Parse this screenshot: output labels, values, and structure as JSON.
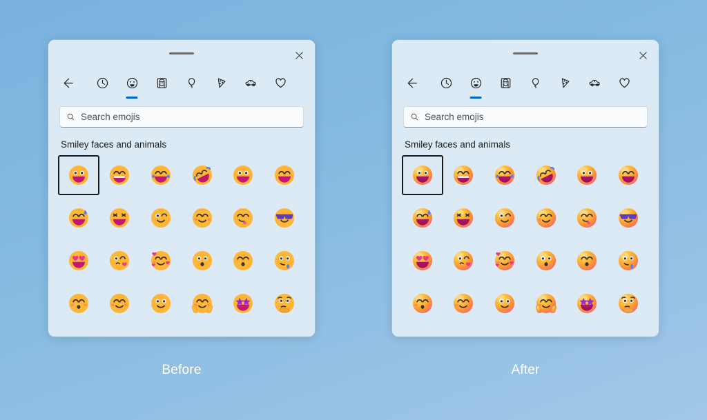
{
  "background": {
    "from": "#79b3de",
    "to": "#a2c7e7"
  },
  "accent": "#0067c0",
  "panels": [
    {
      "id": "before",
      "caption": "Before",
      "style": "flat",
      "titlebar": {
        "drag_handle": "drag-handle",
        "close_label": "Close"
      },
      "toolbar": {
        "back_label": "Back",
        "items": [
          {
            "icon": "clock-icon",
            "label": "Recently used",
            "active": false
          },
          {
            "icon": "smiley-icon",
            "label": "Smiley faces and animals",
            "active": true
          },
          {
            "icon": "person-icon",
            "label": "People",
            "active": false
          },
          {
            "icon": "balloon-icon",
            "label": "Celebration and objects",
            "active": false
          },
          {
            "icon": "pizza-icon",
            "label": "Food and plants",
            "active": false
          },
          {
            "icon": "car-icon",
            "label": "Transportation and places",
            "active": false
          },
          {
            "icon": "heart-icon",
            "label": "Symbols",
            "active": false
          }
        ]
      },
      "search": {
        "placeholder": "Search emojis",
        "value": "",
        "icon": "search-icon"
      },
      "section_title": "Smiley faces and animals",
      "emojis": [
        {
          "name": "grinning-face",
          "char": "😃",
          "selected": true
        },
        {
          "name": "beaming-face-smiling-eyes",
          "char": "😁",
          "selected": false
        },
        {
          "name": "face-with-tears-of-joy",
          "char": "😂",
          "selected": false
        },
        {
          "name": "rolling-on-floor-laughing",
          "char": "🤣",
          "selected": false
        },
        {
          "name": "grinning-face-big-eyes",
          "char": "😄",
          "selected": false
        },
        {
          "name": "grinning-face-smiling-eyes",
          "char": "😅",
          "selected": false
        },
        {
          "name": "grinning-face-sweat",
          "char": "😅",
          "selected": false
        },
        {
          "name": "squinting-face-with-tongue",
          "char": "😆",
          "selected": false
        },
        {
          "name": "winking-face",
          "char": "😉",
          "selected": false
        },
        {
          "name": "smiling-face-smiling-eyes",
          "char": "😊",
          "selected": false
        },
        {
          "name": "face-savoring-food",
          "char": "😋",
          "selected": false
        },
        {
          "name": "smiling-face-with-sunglasses",
          "char": "😎",
          "selected": false
        },
        {
          "name": "smiling-face-with-heart-eyes",
          "char": "😍",
          "selected": false
        },
        {
          "name": "face-blowing-a-kiss",
          "char": "😘",
          "selected": false
        },
        {
          "name": "smiling-face-with-hearts",
          "char": "🥰",
          "selected": false
        },
        {
          "name": "kissing-face",
          "char": "😗",
          "selected": false
        },
        {
          "name": "kissing-face-smiling-eyes",
          "char": "😙",
          "selected": false
        },
        {
          "name": "drooling-face",
          "char": "🤤",
          "selected": false
        },
        {
          "name": "kissing-face-closed-eyes",
          "char": "😚",
          "selected": false
        },
        {
          "name": "relieved-face",
          "char": "😌",
          "selected": false
        },
        {
          "name": "slightly-smiling-face",
          "char": "🙂",
          "selected": false
        },
        {
          "name": "smiling-face-with-open-hands",
          "char": "🤗",
          "selected": false
        },
        {
          "name": "star-struck",
          "char": "🤩",
          "selected": false
        },
        {
          "name": "thinking-face",
          "char": "🤔",
          "selected": false
        }
      ]
    },
    {
      "id": "after",
      "caption": "After",
      "style": "3d",
      "titlebar": {
        "drag_handle": "drag-handle",
        "close_label": "Close"
      },
      "toolbar": {
        "back_label": "Back",
        "items": [
          {
            "icon": "clock-icon",
            "label": "Recently used",
            "active": false
          },
          {
            "icon": "smiley-icon",
            "label": "Smiley faces and animals",
            "active": true
          },
          {
            "icon": "person-icon",
            "label": "People",
            "active": false
          },
          {
            "icon": "balloon-icon",
            "label": "Celebration and objects",
            "active": false
          },
          {
            "icon": "pizza-icon",
            "label": "Food and plants",
            "active": false
          },
          {
            "icon": "car-icon",
            "label": "Transportation and places",
            "active": false
          },
          {
            "icon": "heart-icon",
            "label": "Symbols",
            "active": false
          }
        ]
      },
      "search": {
        "placeholder": "Search emojis",
        "value": "",
        "icon": "search-icon"
      },
      "section_title": "Smiley faces and animals",
      "emojis": [
        {
          "name": "grinning-face",
          "char": "😃",
          "selected": true
        },
        {
          "name": "beaming-face-smiling-eyes",
          "char": "😁",
          "selected": false
        },
        {
          "name": "face-with-tears-of-joy",
          "char": "😂",
          "selected": false
        },
        {
          "name": "rolling-on-floor-laughing",
          "char": "🤣",
          "selected": false
        },
        {
          "name": "grinning-face-big-eyes",
          "char": "😄",
          "selected": false
        },
        {
          "name": "grinning-face-smiling-eyes",
          "char": "😅",
          "selected": false
        },
        {
          "name": "grinning-face-sweat",
          "char": "😅",
          "selected": false
        },
        {
          "name": "squinting-face-with-tongue",
          "char": "😆",
          "selected": false
        },
        {
          "name": "winking-face",
          "char": "😉",
          "selected": false
        },
        {
          "name": "smiling-face-smiling-eyes",
          "char": "😊",
          "selected": false
        },
        {
          "name": "face-savoring-food",
          "char": "😋",
          "selected": false
        },
        {
          "name": "smiling-face-with-sunglasses",
          "char": "😎",
          "selected": false
        },
        {
          "name": "smiling-face-with-heart-eyes",
          "char": "😍",
          "selected": false
        },
        {
          "name": "face-blowing-a-kiss",
          "char": "😘",
          "selected": false
        },
        {
          "name": "smiling-face-with-hearts",
          "char": "🥰",
          "selected": false
        },
        {
          "name": "kissing-face",
          "char": "😗",
          "selected": false
        },
        {
          "name": "kissing-face-smiling-eyes",
          "char": "😙",
          "selected": false
        },
        {
          "name": "drooling-face",
          "char": "🤤",
          "selected": false
        },
        {
          "name": "kissing-face-closed-eyes",
          "char": "😚",
          "selected": false
        },
        {
          "name": "relieved-face",
          "char": "😌",
          "selected": false
        },
        {
          "name": "slightly-smiling-face",
          "char": "🙂",
          "selected": false
        },
        {
          "name": "smiling-face-with-open-hands",
          "char": "🤗",
          "selected": false
        },
        {
          "name": "star-struck",
          "char": "🤩",
          "selected": false
        },
        {
          "name": "thinking-face",
          "char": "🤔",
          "selected": false
        }
      ]
    }
  ]
}
